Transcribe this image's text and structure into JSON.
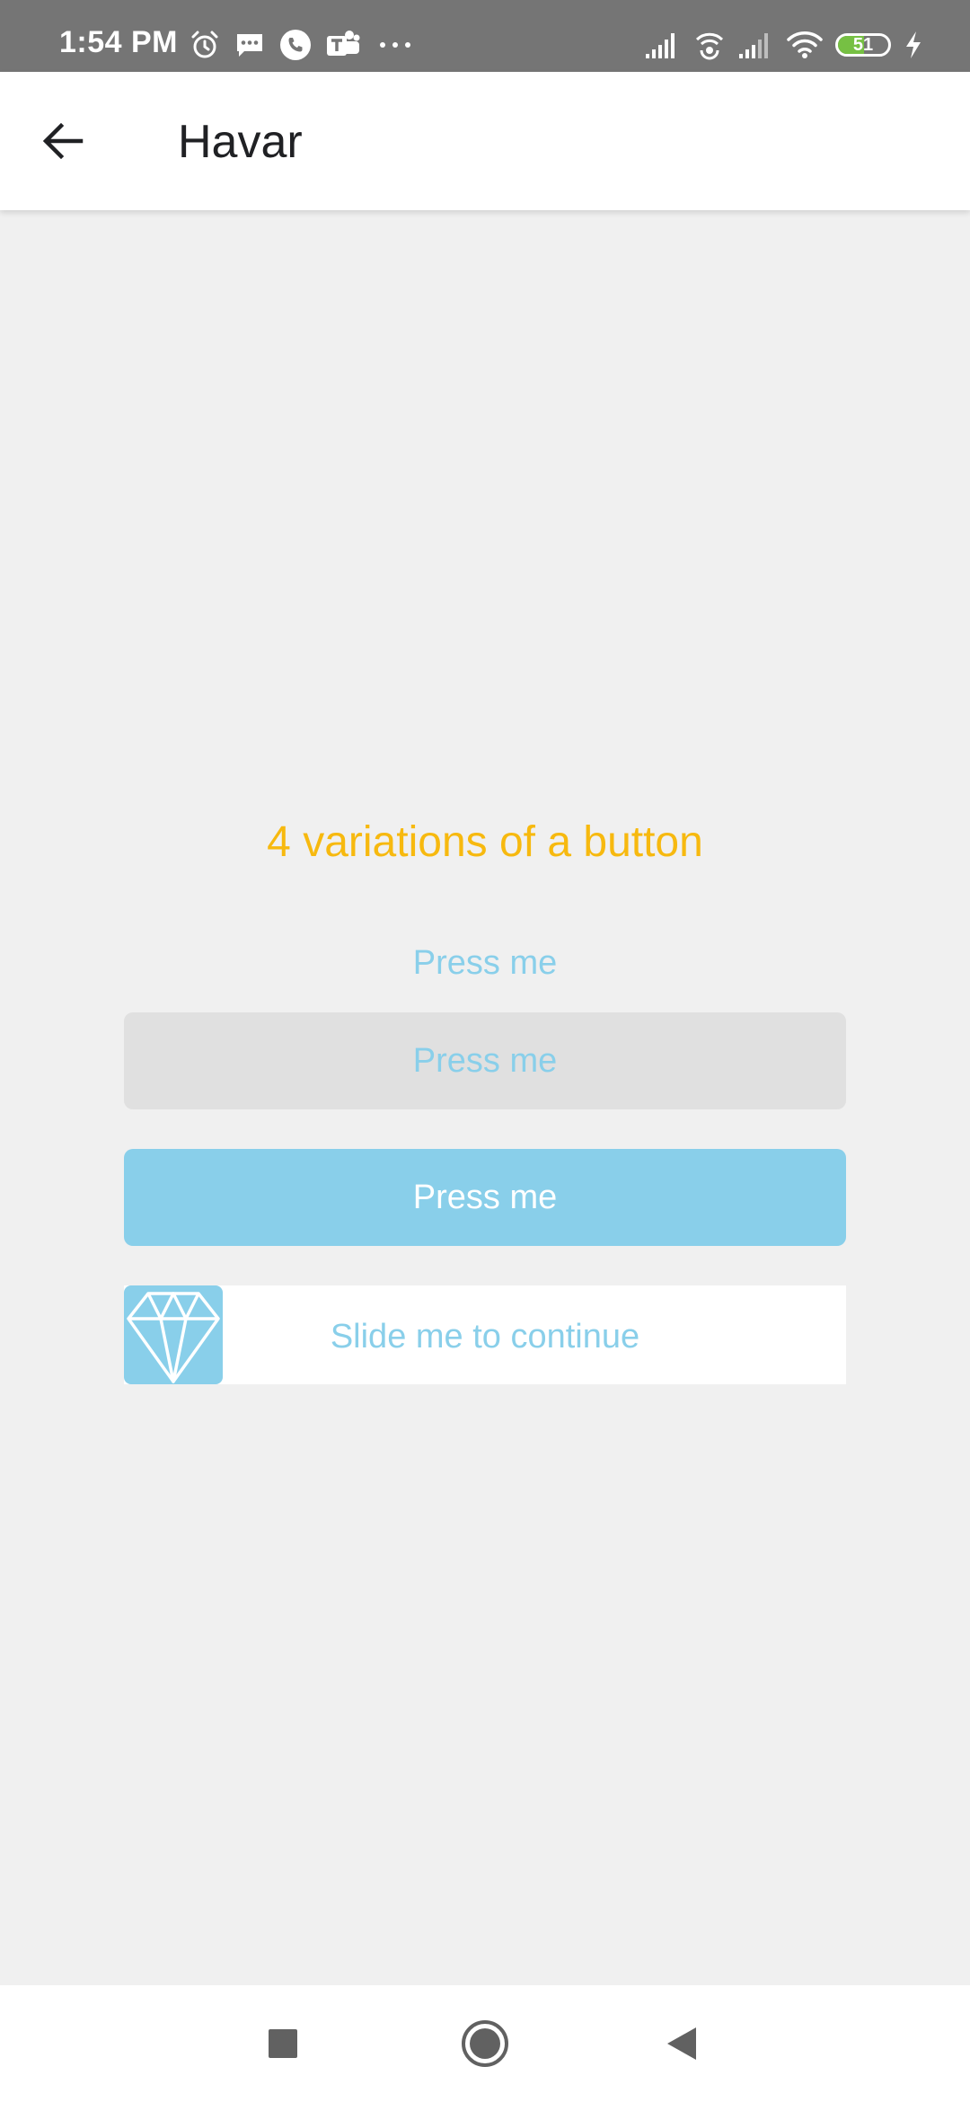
{
  "status_bar": {
    "time": "1:54 PM",
    "battery_level": "51",
    "battery_fraction": 0.51,
    "left_icons": [
      "alarm-icon",
      "message-icon",
      "phone-icon",
      "teams-icon",
      "more-icon"
    ],
    "right_icons": [
      "signal-icon",
      "hotspot-icon",
      "signal-icon-2",
      "wifi-icon",
      "battery-icon",
      "charging-icon"
    ]
  },
  "app_bar": {
    "back_icon": "arrow-back-icon",
    "title": "Havar"
  },
  "content": {
    "heading": "4 variations of a button",
    "text_button_label": "Press me",
    "grey_button_label": "Press me",
    "blue_button_label": "Press me",
    "slider_label": "Slide me to continue",
    "slider_icon": "diamond-icon"
  },
  "colors": {
    "accent": "#89cfea",
    "heading": "#f7b90f",
    "status_bar": "#757575",
    "background": "#f0f0f0"
  },
  "nav_bar": {
    "icons": [
      "recents-square-icon",
      "home-circle-icon",
      "back-triangle-icon"
    ]
  }
}
